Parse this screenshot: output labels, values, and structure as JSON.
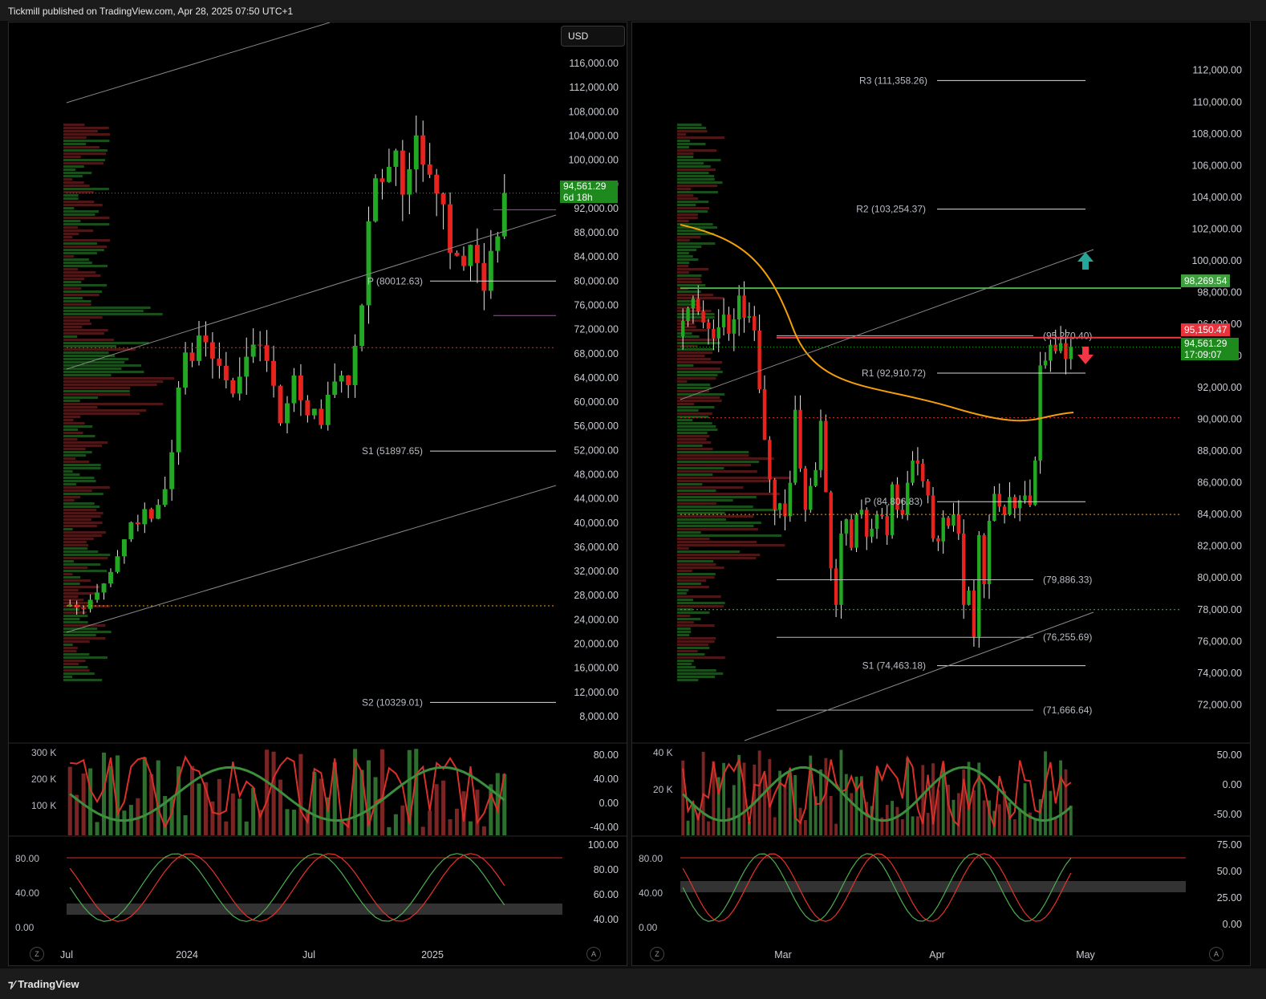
{
  "header": {
    "publish_text": "Tickmill published on TradingView.com, Apr 28, 2025 07:50 UTC+1"
  },
  "footer": {
    "logo_text": "TradingView",
    "z_label": "Z",
    "a_label": "A"
  },
  "currency": "USD",
  "colors": {
    "up": "#22a822",
    "down": "#e8221c",
    "pivot_line": "#d9d9d9",
    "orange_ma": "#f59e0b",
    "green_level": "#4caf50",
    "red_level": "#f23645",
    "magenta": "#cc33cc"
  },
  "chart_data": [
    {
      "id": "left-weekly",
      "type": "candlestick",
      "x_ticks": [
        "Jul",
        "2024",
        "Jul",
        "2025"
      ],
      "y_ticks": [
        "116,000.00",
        "112,000.00",
        "108,000.00",
        "104,000.00",
        "100,000.00",
        "96,000.00",
        "92,000.00",
        "88,000.00",
        "84,000.00",
        "80,000.00",
        "76,000.00",
        "72,000.00",
        "68,000.00",
        "64,000.00",
        "60,000.00",
        "56,000.00",
        "52,000.00",
        "48,000.00",
        "44,000.00",
        "40,000.00",
        "36,000.00",
        "32,000.00",
        "28,000.00",
        "24,000.00",
        "20,000.00",
        "16,000.00",
        "12,000.00",
        "8,000.00"
      ],
      "ylim": [
        6000,
        118000
      ],
      "pivot_labels": [
        "P (80012.63)",
        "S1 (51897.65)",
        "S2 (10329.01)"
      ],
      "last_price": "94,561.29",
      "countdown": "6d 18h",
      "closes": [
        26500,
        26000,
        25800,
        27300,
        28500,
        30000,
        31900,
        34500,
        37300,
        40100,
        39800,
        42300,
        40700,
        43000,
        45600,
        51700,
        62400,
        68200,
        66800,
        71000,
        69900,
        67200,
        66000,
        63600,
        61400,
        64200,
        67500,
        69500,
        69400,
        66800,
        62700,
        56500,
        59800,
        64400,
        60300,
        57800,
        58900,
        56200,
        61200,
        63400,
        64400,
        62800,
        69300,
        76000,
        89900,
        97000,
        96400,
        98900,
        101600,
        94300,
        98500,
        104100,
        99300,
        97600,
        94500,
        92700,
        84700,
        84200,
        82500,
        86000,
        83000,
        78400,
        85000,
        87400,
        94561
      ],
      "volume_ticks": [
        "300 K",
        "200 K",
        "100 K"
      ],
      "osc1_ticks": [
        "80.00",
        "40.00",
        "0.00",
        "-40.00"
      ],
      "stoch_left_ticks": [
        "80.00",
        "40.00",
        "0.00"
      ],
      "stoch_right_ticks": [
        "100.00",
        "80.00",
        "60.00",
        "40.00"
      ]
    },
    {
      "id": "right-daily",
      "type": "candlestick",
      "x_ticks": [
        "Mar",
        "Apr",
        "May"
      ],
      "y_ticks": [
        "112,000.00",
        "110,000.00",
        "108,000.00",
        "106,000.00",
        "104,000.00",
        "102,000.00",
        "100,000.00",
        "98,000.00",
        "96,000.00",
        "94,000.00",
        "92,000.00",
        "90,000.00",
        "88,000.00",
        "86,000.00",
        "84,000.00",
        "82,000.00",
        "80,000.00",
        "78,000.00",
        "76,000.00",
        "74,000.00",
        "72,000.00"
      ],
      "ylim": [
        70500,
        113200
      ],
      "pivot_labels": [
        "R3 (111,358.26)",
        "R2 (103,254.37)",
        "R1 (92,910.72)",
        "P (84,806.83)",
        "S1 (74,463.18)",
        "(95,270.40)",
        "(79,886.33)",
        "(76,255.69)",
        "(71,666.64)"
      ],
      "level_tags": [
        "98,269.54",
        "95,150.47"
      ],
      "last_price": "94,561.29",
      "countdown": "17:09:07",
      "closes": [
        96200,
        97000,
        97600,
        96800,
        96100,
        95700,
        95100,
        95800,
        96600,
        95400,
        96300,
        97800,
        96400,
        96500,
        95600,
        91900,
        88700,
        86200,
        84300,
        84700,
        83900,
        86000,
        90600,
        86900,
        84300,
        85800,
        86800,
        89900,
        85400,
        80600,
        78300,
        82800,
        83700,
        81900,
        84000,
        84300,
        82600,
        83100,
        84000,
        83900,
        82700,
        85900,
        84300,
        84000,
        86000,
        87400,
        87200,
        86100,
        85200,
        82500,
        82300,
        83800,
        83300,
        84000,
        82800,
        78300,
        79200,
        76300,
        82700,
        79600,
        83600,
        85300,
        84500,
        84000,
        85100,
        84400,
        84900,
        85200,
        84600,
        87400,
        93400,
        93700,
        94700,
        94300,
        94800,
        93800,
        94561
      ],
      "volume_ticks": [
        "40 K",
        "20 K"
      ],
      "osc1_ticks": [
        "50.00",
        "0.00",
        "-50.00"
      ],
      "stoch_left_ticks": [
        "80.00",
        "40.00",
        "0.00"
      ],
      "stoch_right_ticks": [
        "75.00",
        "50.00",
        "25.00",
        "0.00"
      ]
    }
  ]
}
